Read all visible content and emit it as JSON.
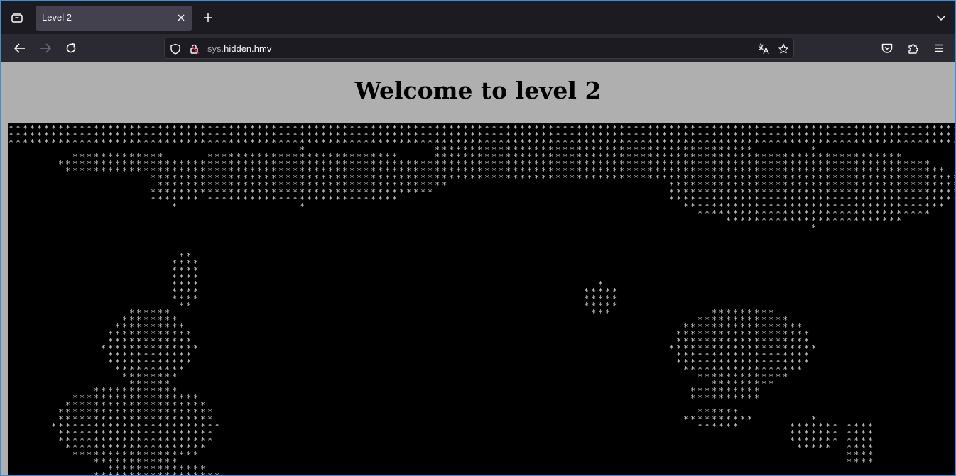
{
  "browser": {
    "tab": {
      "title": "Level 2"
    },
    "url": {
      "subdomain": "sys.",
      "domain": "hidden.hmv"
    }
  },
  "page": {
    "heading": "Welcome to level 2"
  },
  "icons": {
    "tab_list": "tab-list-icon",
    "close": "close-icon",
    "new_tab": "plus-icon",
    "list_all_tabs": "chevron-down-icon",
    "back": "arrow-left-icon",
    "forward": "arrow-right-icon",
    "reload": "reload-icon",
    "tracking_protection": "shield-icon",
    "insecure_connection": "lock-warning-icon",
    "translate": "translate-icon",
    "bookmark": "star-icon",
    "pocket": "pocket-icon",
    "extensions": "puzzle-icon",
    "menu": "hamburger-icon"
  },
  "colors": {
    "accent_border": "#3f8fd6",
    "page_background": "#afafaf",
    "map_background": "#000000",
    "map_glyph": "#c8c8c8"
  },
  "map": {
    "glyph": "*"
  }
}
